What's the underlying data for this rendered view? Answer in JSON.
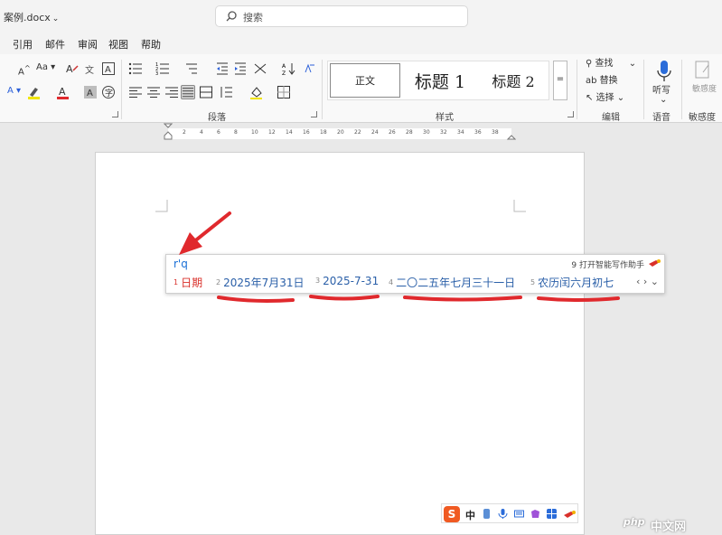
{
  "titlebar": {
    "doc_name": "案例.docx",
    "search_placeholder": "搜索"
  },
  "menu": [
    "引用",
    "邮件",
    "审阅",
    "视图",
    "帮助"
  ],
  "ribbon": {
    "font_size_inc": "A",
    "font_size_dec": "A",
    "font_case": "Aa",
    "groups": {
      "paragraph": "段落",
      "styles": "样式",
      "editing": "编辑",
      "voice": "语音",
      "sensitivity": "敏感度"
    },
    "styles": [
      {
        "label": "正文"
      },
      {
        "label": "标题 1"
      },
      {
        "label": "标题 2"
      }
    ],
    "editing": {
      "find": "查找",
      "replace": "替换",
      "select": "选择"
    },
    "dictate": "听写",
    "sensitivity_btn": "敏感度"
  },
  "ruler_numbers": [
    "2",
    "4",
    "6",
    "8",
    "10",
    "12",
    "14",
    "16",
    "18",
    "20",
    "22",
    "24",
    "26",
    "28",
    "30",
    "32",
    "34",
    "36",
    "38"
  ],
  "ime": {
    "input": "r'q",
    "tip": "9 打开智能写作助手",
    "candidates": [
      {
        "num": "1",
        "text": "日期"
      },
      {
        "num": "2",
        "text": "2025年7月31日"
      },
      {
        "num": "3",
        "text": "2025-7-31"
      },
      {
        "num": "4",
        "text": "二〇二五年七月三十一日"
      },
      {
        "num": "5",
        "text": "农历闰六月初七"
      }
    ],
    "nav": "‹ › ⌄"
  },
  "ime_bar": {
    "logo": "S",
    "mode": "中"
  },
  "watermark": {
    "logo": "php",
    "text": "中文网"
  },
  "colors": {
    "accent_red": "#e0292d",
    "candidate_blue": "#2a5fa8",
    "sogou_orange": "#f05a22"
  }
}
